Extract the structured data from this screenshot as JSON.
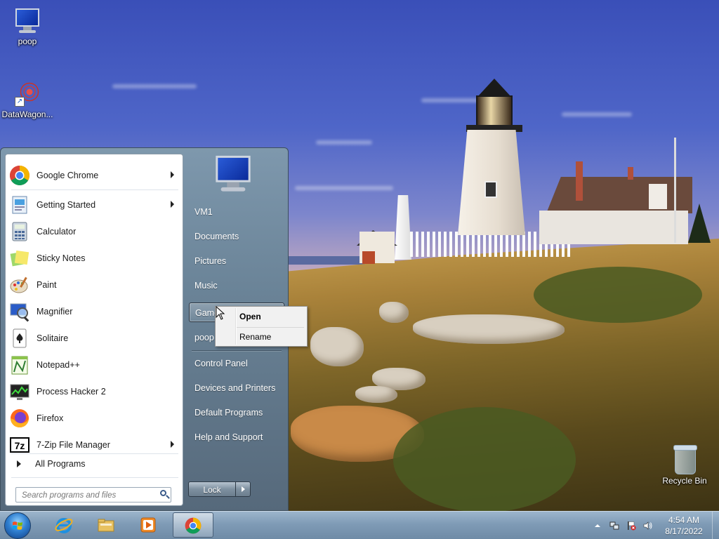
{
  "desktop": {
    "icons": [
      {
        "label": "poop",
        "icon": "computer-icon"
      },
      {
        "label": "DataWagon...",
        "icon": "datawagon-icon"
      },
      {
        "label": "Recycle Bin",
        "icon": "recycle-bin-icon"
      }
    ]
  },
  "start_menu": {
    "programs": [
      {
        "label": "Google Chrome",
        "icon": "chrome-icon",
        "submenu": true
      },
      {
        "label": "Getting Started",
        "icon": "getting-started-icon",
        "submenu": true
      },
      {
        "label": "Calculator",
        "icon": "calculator-icon",
        "submenu": false
      },
      {
        "label": "Sticky Notes",
        "icon": "sticky-notes-icon",
        "submenu": false
      },
      {
        "label": "Paint",
        "icon": "paint-icon",
        "submenu": false
      },
      {
        "label": "Magnifier",
        "icon": "magnifier-icon",
        "submenu": false
      },
      {
        "label": "Solitaire",
        "icon": "solitaire-icon",
        "submenu": false
      },
      {
        "label": "Notepad++",
        "icon": "notepadpp-icon",
        "submenu": false
      },
      {
        "label": "Process Hacker 2",
        "icon": "process-hacker-icon",
        "submenu": false
      },
      {
        "label": "Firefox",
        "icon": "firefox-icon",
        "submenu": false
      },
      {
        "label": "7-Zip File Manager",
        "icon": "7zip-icon",
        "submenu": true
      }
    ],
    "all_programs": "All Programs",
    "search_placeholder": "Search programs and files",
    "right_items": [
      "VM1",
      "Documents",
      "Pictures",
      "Music",
      "Games",
      "poop",
      "Control Panel",
      "Devices and Printers",
      "Default Programs",
      "Help and Support"
    ],
    "highlighted_item": "Games",
    "lock_label": "Lock"
  },
  "context_menu": {
    "items": [
      {
        "label": "Open",
        "default": true
      },
      {
        "label": "Rename",
        "default": false
      }
    ]
  },
  "taskbar": {
    "pinned": [
      "internet-explorer-icon",
      "explorer-folder-icon",
      "media-player-icon",
      "chrome-icon"
    ],
    "active": "chrome-icon",
    "clock": {
      "time": "4:54 AM",
      "date": "8/17/2022"
    }
  },
  "colors": {
    "taskbar": "#7f9bb6",
    "start_menu": "#6a8397",
    "wallpaper_sky": "#4f66c8"
  }
}
